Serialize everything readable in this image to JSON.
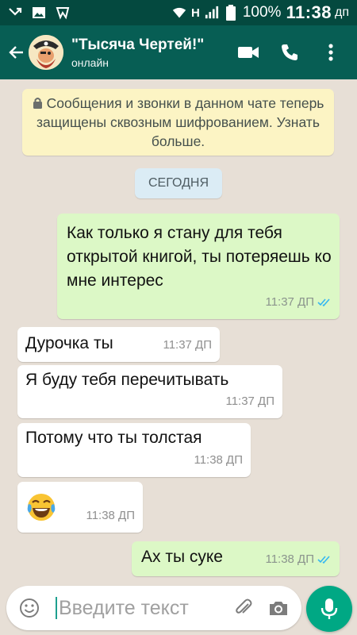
{
  "status_bar": {
    "network": "H",
    "battery": "100%",
    "time": "11:38",
    "time_suffix": "дп"
  },
  "header": {
    "contact_name": "\"Тысяча Чертей!\"",
    "status": "онлайн",
    "icons": [
      "back-arrow-icon",
      "video-call-icon",
      "phone-icon",
      "more-icon"
    ]
  },
  "encryption_notice": "Сообщения и звонки в данном чате теперь защищены сквозным шифрованием. Узнать больше.",
  "date_separator": "СЕГОДНЯ",
  "messages": [
    {
      "direction": "out",
      "text": "Как только я стану для тебя открытой книгой, ты потеряешь ко мне интерес",
      "time": "11:37 ДП"
    },
    {
      "direction": "in",
      "text": "Дурочка ты",
      "time": "11:37 ДП"
    },
    {
      "direction": "in",
      "text": "Я буду тебя перечитывать",
      "time": "11:37 ДП"
    },
    {
      "direction": "in",
      "text": "Потому что ты толстая",
      "time": "11:38 ДП"
    },
    {
      "direction": "in",
      "text": "",
      "emoji": "tears-of-joy-emoji",
      "time": "11:38 ДП"
    },
    {
      "direction": "out",
      "text": "Ах ты суке",
      "time": "11:38 ДП"
    }
  ],
  "composer": {
    "placeholder": "Введите текст"
  },
  "colors": {
    "status_bar": "#04493f",
    "header": "#075e54",
    "outgoing_bubble": "#dcf8c6",
    "incoming_bubble": "#ffffff",
    "read_ticks": "#34b7f1",
    "mic_button": "#00a884"
  }
}
